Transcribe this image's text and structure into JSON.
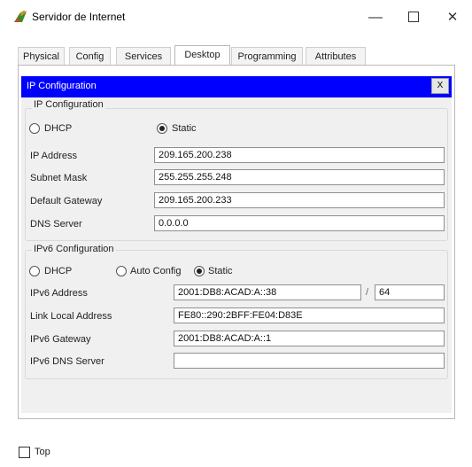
{
  "window": {
    "title": "Servidor de Internet",
    "minimize_glyph": "—",
    "close_glyph": "✕"
  },
  "tabs": [
    "Physical",
    "Config",
    "Services",
    "Desktop",
    "Programming",
    "Attributes"
  ],
  "active_tab": "Desktop",
  "ip_config": {
    "title_bar": "IP Configuration",
    "close_label": "X",
    "section_title": "IP Configuration",
    "dhcp_label": "DHCP",
    "static_label": "Static",
    "mode": "Static",
    "ip_address_label": "IP Address",
    "ip_address": "209.165.200.238",
    "subnet_mask_label": "Subnet Mask",
    "subnet_mask": "255.255.255.248",
    "default_gateway_label": "Default Gateway",
    "default_gateway": "209.165.200.233",
    "dns_server_label": "DNS Server",
    "dns_server": "0.0.0.0"
  },
  "ipv6_config": {
    "section_title": "IPv6 Configuration",
    "dhcp_label": "DHCP",
    "auto_config_label": "Auto Config",
    "static_label": "Static",
    "mode": "Static",
    "ipv6_address_label": "IPv6 Address",
    "ipv6_address": "2001:DB8:ACAD:A::38",
    "prefix_separator": "/",
    "prefix_length": "64",
    "link_local_label": "Link Local Address",
    "link_local": "FE80::290:2BFF:FE04:D83E",
    "ipv6_gateway_label": "IPv6 Gateway",
    "ipv6_gateway": "2001:DB8:ACAD:A::1",
    "ipv6_dns_label": "IPv6 DNS Server",
    "ipv6_dns": ""
  },
  "footer": {
    "top_label": "Top",
    "top_checked": false
  },
  "colors": {
    "title_bar_blue": "#0000ff",
    "panel_bg": "#f0f0f0",
    "icon_green": "#3a8a2e",
    "icon_orange": "#e08a1e"
  },
  "icons": {
    "app": "packet-tracer-server-icon"
  }
}
